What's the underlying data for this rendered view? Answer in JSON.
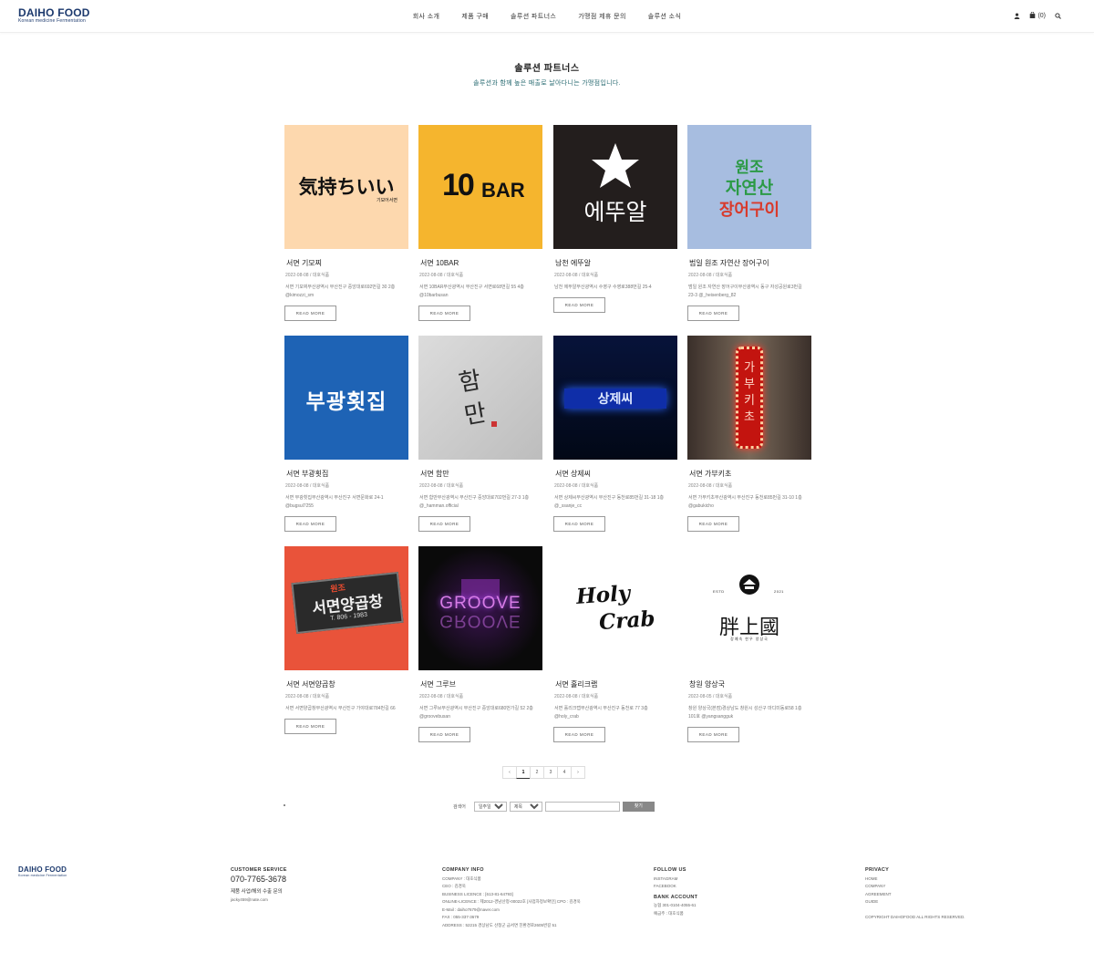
{
  "brand": {
    "name": "DAIHO FOOD",
    "tagline": "Korean medicine Fermentation"
  },
  "nav": [
    "회사 소개",
    "제품 구매",
    "솔루션 파트너스",
    "가맹점 제휴 문의",
    "솔루션 소식"
  ],
  "header": {
    "cart_count": "(0)"
  },
  "page": {
    "title": "솔루션 파트너스",
    "subtitle": "솔루션과 함께 높은 매출로 날아다니는 가맹점입니다."
  },
  "cards": [
    {
      "title": "서면 기모찌",
      "date": "2022-08-08 / 대호식품",
      "desc": "서면 기모찌부산광역시 부산진구 중앙대로692번길 30 2층 @kimozzi_sm",
      "read_more": "READ MORE",
      "thumb_text": "気持ちいい",
      "thumb_sub": "기모어서면"
    },
    {
      "title": "서면 10BAR",
      "date": "2022-08-08 / 대호식품",
      "desc": "서면 10BAR부산광역시 부산진구 서면로68번길 55 4층 @10barbusan",
      "read_more": "READ MORE",
      "thumb_text": "10",
      "thumb_sub": "BAR"
    },
    {
      "title": "남천 에뚜알",
      "date": "2022-08-08 / 대호식품",
      "desc": "남천 에뚜알부산광역시 수영구 수영로388번길 25-4",
      "read_more": "READ MORE",
      "thumb_text": "에뚜알"
    },
    {
      "title": "범일 원조 자연산 장어구이",
      "date": "2022-08-08 / 대호식품",
      "desc": "범일 원조 자연산 장어구이부산광역시 동구 자성공원로3번길 23-3 @_heisenberg_82",
      "read_more": "READ MORE",
      "thumb_text": "원조",
      "thumb_line2": "자연산",
      "thumb_line3": "장어구이"
    },
    {
      "title": "서면 부광횟집",
      "date": "2022-08-08 / 대호식품",
      "desc": "서면 부광횟집부산광역시 부산진구 서면문화로 24-1 @bugsul7255",
      "read_more": "READ MORE",
      "thumb_text": "부광횟집"
    },
    {
      "title": "서면 함만",
      "date": "2022-08-08 / 대호식품",
      "desc": "서면 함만부산광역시 부산진구 중앙대로702번길 27-3 1층 @_hamman.official",
      "read_more": "READ MORE",
      "thumb_text": "함",
      "thumb_sub": "만"
    },
    {
      "title": "서면 상제씨",
      "date": "2022-08-08 / 대호식품",
      "desc": "서면 상제씨부산광역시 부산진구 동천로85번길 31-18 1층 @_ssanje_cc",
      "read_more": "READ MORE",
      "thumb_text": "상제씨"
    },
    {
      "title": "서면 가부키초",
      "date": "2022-08-08 / 대호식품",
      "desc": "서면 가부키초부산광역시 부산진구 동천로85번길 31-10 1층 @gabukicho",
      "read_more": "READ MORE",
      "thumb_text": "가부키초"
    },
    {
      "title": "서면 서면양곱창",
      "date": "2022-08-08 / 대호식품",
      "desc": "서면 서면양곱창부산광역시 부산진구 가야대로784번길 66",
      "read_more": "READ MORE",
      "thumb_text": "서면양곱창",
      "thumb_sub": "T. 806 - 1983",
      "thumb_top": "원조"
    },
    {
      "title": "서면 그루브",
      "date": "2022-08-08 / 대호식품",
      "desc": "서면 그루브부산광역시 부산진구 중앙대로680번가길 52 2층 @groovebusan",
      "read_more": "READ MORE",
      "thumb_text": "GROOVE"
    },
    {
      "title": "서면 홀리크랩",
      "date": "2022-08-08 / 대호식품",
      "desc": "서면 홀리크랩부산광역시 부산진구 동천로 77 3층 @holy_crab",
      "read_more": "READ MORE",
      "thumb_text": "Holy",
      "thumb_sub": "Crab"
    },
    {
      "title": "창원 양상국",
      "date": "2022-08-05 / 대호식품",
      "desc": "창원 양상국(본점)경상남도 창원시 성산구 마디미동로58 1층 101호 @yangsangguk",
      "read_more": "READ MORE",
      "thumb_text": "胖上國",
      "thumb_sub": "ESTD",
      "thumb_year": "2021",
      "thumb_foot": "장예숙 한우 양상국"
    }
  ],
  "pagination": {
    "prev": "‹",
    "pages": [
      "1",
      "2",
      "3",
      "4"
    ],
    "next": "›",
    "active": "1"
  },
  "search": {
    "label": "검색어",
    "option1": "일주일",
    "option2": "제목",
    "button": "찾기"
  },
  "footer": {
    "customer": {
      "head": "CUSTOMER SERVICE",
      "phone": "070-7765-3678",
      "export_label": "제품 사업/해외 수출 문의",
      "email": "jacky459@nate.com"
    },
    "company": {
      "head": "COMPANY INFO",
      "lines": [
        "COMPANY : 대호식품",
        "CEO : 김경욱",
        "BUSINESS LICENCE : [613-81-64793]",
        "ONLINE-LICENCE : 제2012-경남산청-00022호 [사업자정보확인]    CPO : 김경욱",
        "E-Mail : daiho7679@naver.com",
        "FAX : 055-337-3679",
        "ADDRESS : 52215 경상남도 산청군 금서면 친환경로2605번길 51"
      ]
    },
    "follow": {
      "head": "FOLLOW US",
      "items": [
        "INSTAGRAM",
        "FACEBOOK"
      ]
    },
    "bank": {
      "head": "BANK ACCOUNT",
      "lines": [
        "농협 301-0104-4055-61",
        "예금주 : 대호식품"
      ]
    },
    "privacy": {
      "head": "PRIVACY",
      "items": [
        "HOME",
        "COMPANY",
        "AGREEMENT",
        "GUIDE"
      ],
      "copyright": "COPYRIGHT DAIHOFOOD ALL RIGHTS RESERVED."
    }
  }
}
